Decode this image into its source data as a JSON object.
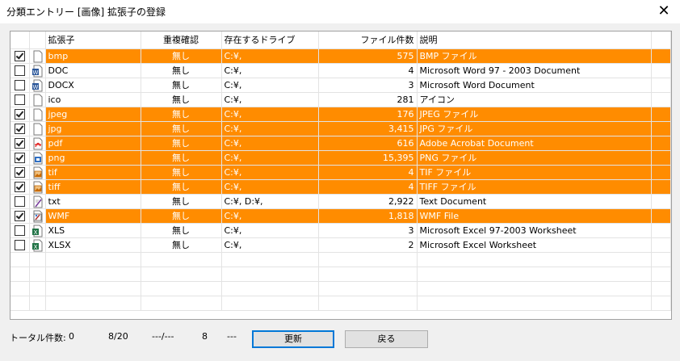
{
  "window": {
    "title": "分類エントリー [画像] 拡張子の登録",
    "close_label": "✕"
  },
  "table": {
    "columns": {
      "ext": "拡張子",
      "dup": "重複確認",
      "drive": "存在するドライブ",
      "count": "ファイル件数",
      "desc": "説明"
    },
    "rows": [
      {
        "checked": true,
        "highlight": true,
        "icon": "blank-file-icon",
        "ext": "bmp",
        "dup": "無し",
        "drive": "C:¥,",
        "count": "575",
        "desc": "BMP ファイル"
      },
      {
        "checked": false,
        "highlight": false,
        "icon": "word-file-icon",
        "ext": "DOC",
        "dup": "無し",
        "drive": "C:¥,",
        "count": "4",
        "desc": "Microsoft Word 97 - 2003 Document"
      },
      {
        "checked": false,
        "highlight": false,
        "icon": "word-file-icon",
        "ext": "DOCX",
        "dup": "無し",
        "drive": "C:¥,",
        "count": "3",
        "desc": "Microsoft Word Document"
      },
      {
        "checked": false,
        "highlight": false,
        "icon": "blank-file-icon",
        "ext": "ico",
        "dup": "無し",
        "drive": "C:¥,",
        "count": "281",
        "desc": "アイコン"
      },
      {
        "checked": true,
        "highlight": true,
        "icon": "blank-file-icon",
        "ext": "jpeg",
        "dup": "無し",
        "drive": "C:¥,",
        "count": "176",
        "desc": "JPEG ファイル"
      },
      {
        "checked": true,
        "highlight": true,
        "icon": "blank-file-icon",
        "ext": "jpg",
        "dup": "無し",
        "drive": "C:¥,",
        "count": "3,415",
        "desc": "JPG ファイル"
      },
      {
        "checked": true,
        "highlight": true,
        "icon": "pdf-file-icon",
        "ext": "pdf",
        "dup": "無し",
        "drive": "C:¥,",
        "count": "616",
        "desc": "Adobe Acrobat Document"
      },
      {
        "checked": true,
        "highlight": true,
        "icon": "png-file-icon",
        "ext": "png",
        "dup": "無し",
        "drive": "C:¥,",
        "count": "15,395",
        "desc": "PNG ファイル"
      },
      {
        "checked": true,
        "highlight": true,
        "icon": "image-file-icon",
        "ext": "tif",
        "dup": "無し",
        "drive": "C:¥,",
        "count": "4",
        "desc": "TIF ファイル"
      },
      {
        "checked": true,
        "highlight": true,
        "icon": "image-file-icon",
        "ext": "tiff",
        "dup": "無し",
        "drive": "C:¥,",
        "count": "4",
        "desc": "TIFF ファイル"
      },
      {
        "checked": false,
        "highlight": false,
        "icon": "text-file-icon",
        "ext": "txt",
        "dup": "無し",
        "drive": "C:¥, D:¥,",
        "count": "2,922",
        "desc": "Text Document"
      },
      {
        "checked": true,
        "highlight": true,
        "icon": "wmf-file-icon",
        "ext": "WMF",
        "dup": "無し",
        "drive": "C:¥,",
        "count": "1,818",
        "desc": "WMF File"
      },
      {
        "checked": false,
        "highlight": false,
        "icon": "excel-file-icon",
        "ext": "XLS",
        "dup": "無し",
        "drive": "C:¥,",
        "count": "3",
        "desc": "Microsoft Excel 97-2003 Worksheet"
      },
      {
        "checked": false,
        "highlight": false,
        "icon": "excel-file-icon",
        "ext": "XLSX",
        "dup": "無し",
        "drive": "C:¥,",
        "count": "2",
        "desc": "Microsoft Excel Worksheet"
      }
    ]
  },
  "status": {
    "total_label": "トータル件数:",
    "total_value": "0",
    "selected": "8/20",
    "range": "---/---",
    "count": "8",
    "dashes": "---"
  },
  "buttons": {
    "refresh": "更新",
    "back": "戻る"
  },
  "colors": {
    "highlight": "#ff8c00"
  }
}
